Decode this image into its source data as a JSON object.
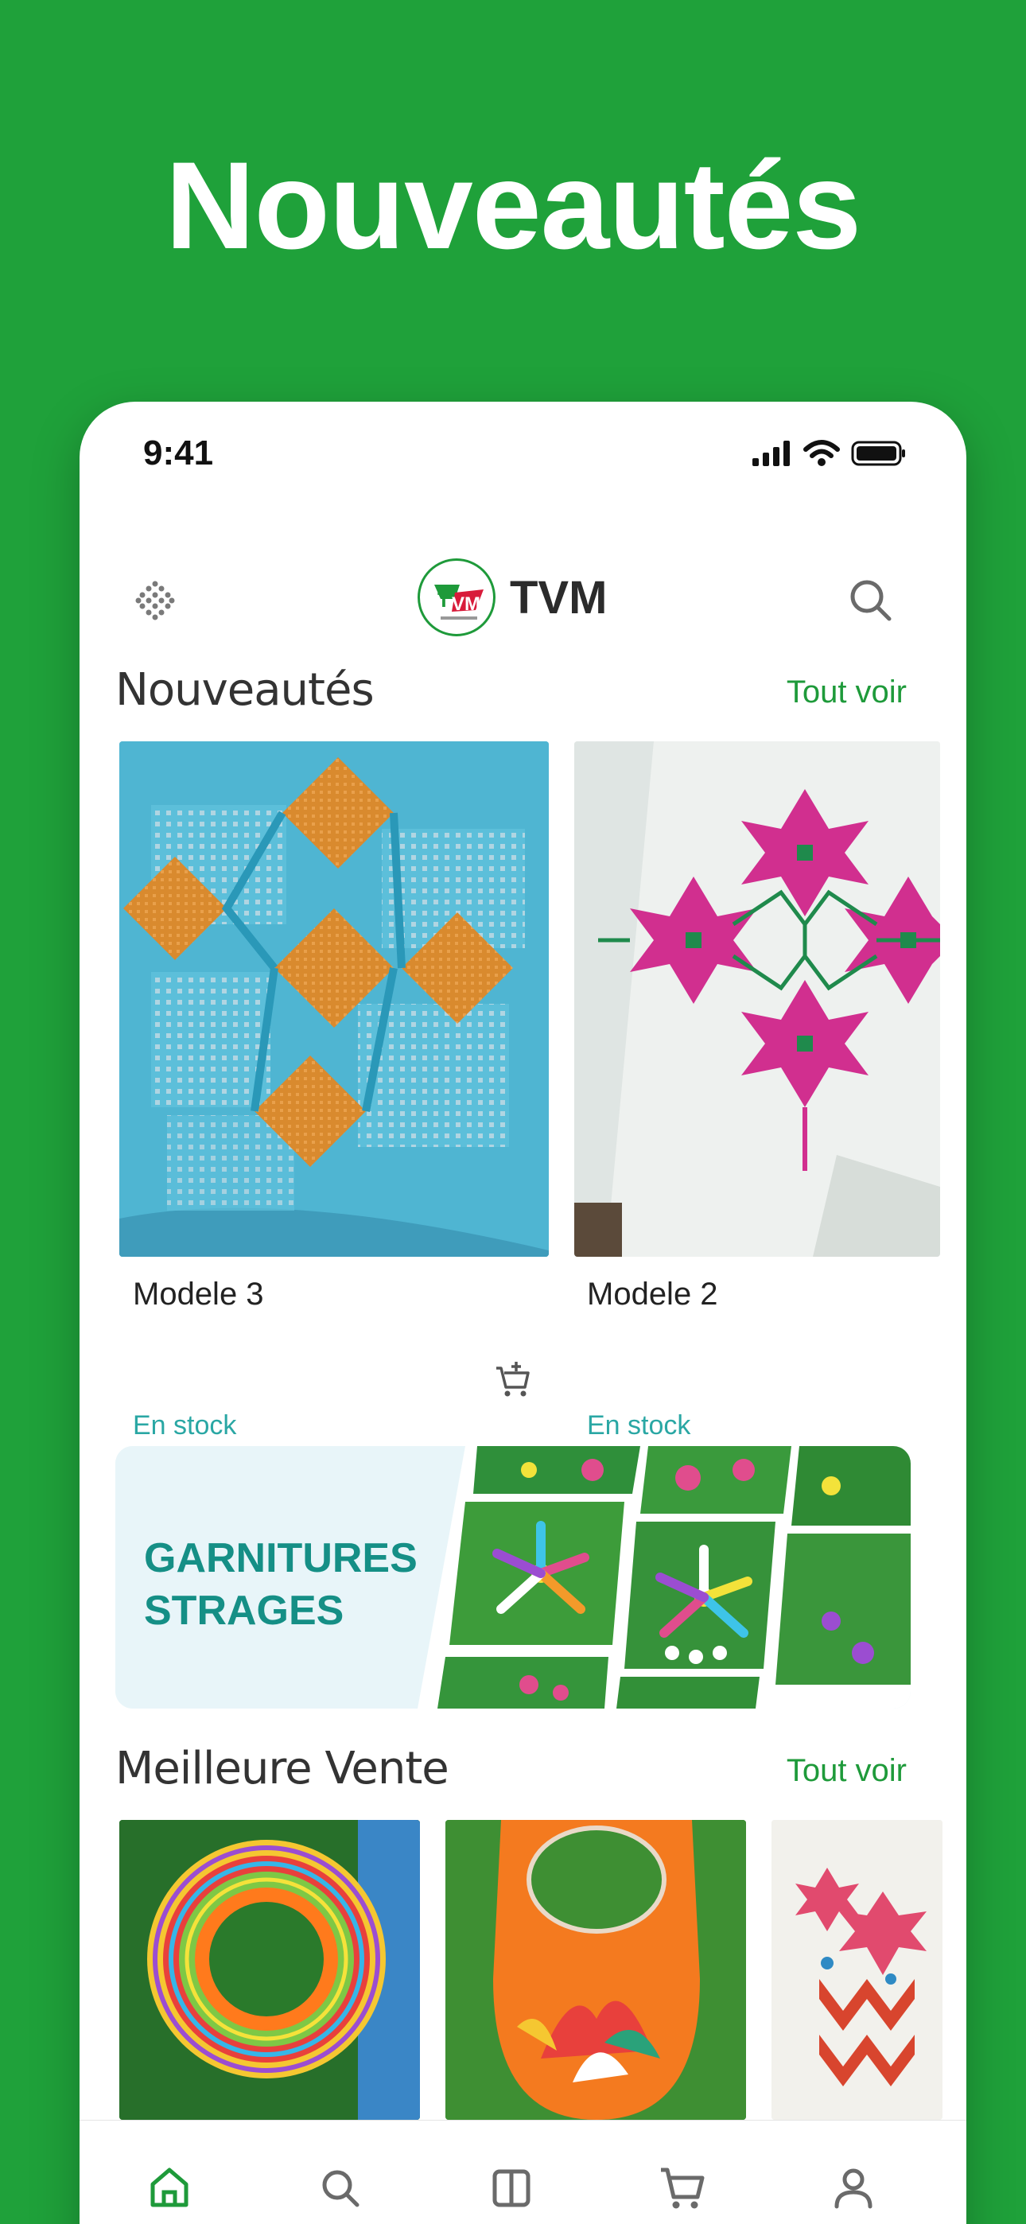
{
  "headline": "Nouveautés",
  "status": {
    "time": "9:41"
  },
  "header": {
    "brand": "TVM",
    "menu_icon": "grid-dots-icon",
    "search_icon": "search-icon"
  },
  "colors": {
    "background": "#1fa13a",
    "accent": "#1e9a3a",
    "stock": "#2aa7a4",
    "banner_text": "#158f86"
  },
  "new_arrivals": {
    "title": "Nouveautés",
    "see_all": "Tout voir",
    "items": [
      {
        "name": "Modele 3",
        "stock": "En stock"
      },
      {
        "name": "Modele 2",
        "stock": "En stock"
      }
    ],
    "cart_icon": "add-to-cart-icon"
  },
  "banner": {
    "line1": "GARNITURES",
    "line2": "STRAGES"
  },
  "best_sellers": {
    "title": "Meilleure Vente",
    "see_all": "Tout voir"
  },
  "bottom_nav": [
    "home-icon",
    "search-icon",
    "catalog-icon",
    "cart-icon",
    "profile-icon"
  ]
}
